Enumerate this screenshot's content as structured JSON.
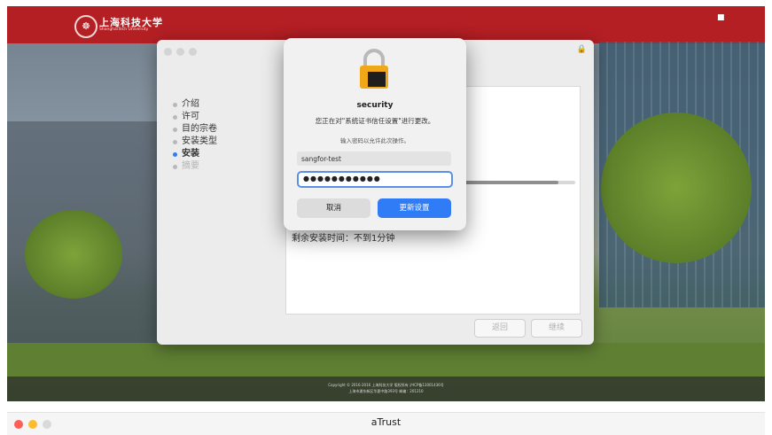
{
  "banner": {
    "logo_text": "上海科技大学",
    "logo_subtext": "ShanghaiTech University",
    "logo_glyph": "☸",
    "corner_icon": "■"
  },
  "footer": {
    "line1": "Copyright © 2016-2016 上海科技大学 版权所有 沪ICP备13001436号",
    "line2": "上海市浦东新区华夏中路393号 邮编：201210"
  },
  "installer": {
    "steps": [
      {
        "label": "介绍",
        "state": "done"
      },
      {
        "label": "许可",
        "state": "done"
      },
      {
        "label": "目的宗卷",
        "state": "done"
      },
      {
        "label": "安装类型",
        "state": "done"
      },
      {
        "label": "安装",
        "state": "active"
      },
      {
        "label": "摘要",
        "state": "pending"
      }
    ],
    "remaining_text": "剩余安装时间：不到1分钟",
    "progress_fraction": 0.85,
    "back_label": "返回",
    "continue_label": "继续"
  },
  "dialog": {
    "title": "security",
    "message": "您正在对\"系统证书信任设置\"进行更改。",
    "prompt": "输入密码以允许此次操作。",
    "username_value": "sangfor-test",
    "password_masked": "●●●●●●●●●●●",
    "cancel_label": "取消",
    "update_label": "更新设置"
  },
  "atrust": {
    "title": "aTrust",
    "traffic_colors": [
      "#ff5f57",
      "#febc2e",
      "#d9d9d9"
    ]
  }
}
